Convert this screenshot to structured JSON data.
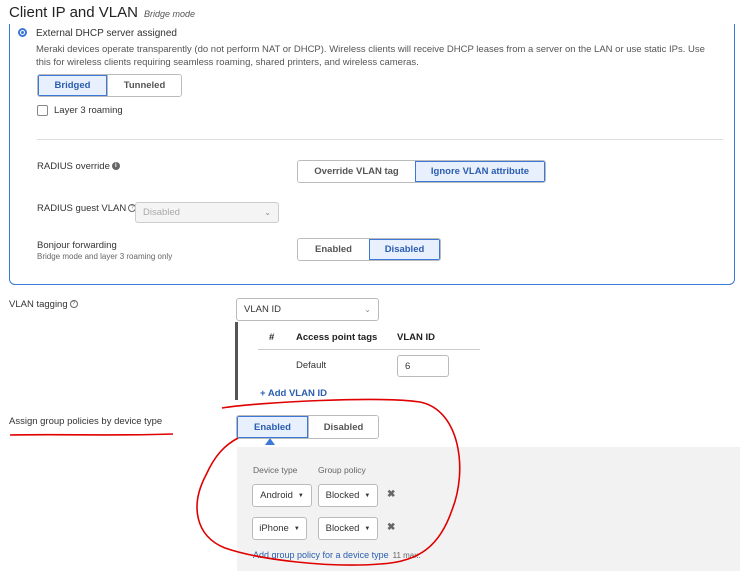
{
  "header": {
    "title": "Client IP and VLAN",
    "subtitle": "Bridge mode"
  },
  "dhcp": {
    "option_label": "External DHCP server assigned",
    "description": "Meraki devices operate transparently (do not perform NAT or DHCP). Wireless clients will receive DHCP leases from a server on the LAN or use static IPs. Use this for wireless clients requiring seamless roaming, shared printers, and wireless cameras.",
    "mode_buttons": [
      "Bridged",
      "Tunneled"
    ],
    "layer3_label": "Layer 3 roaming"
  },
  "radius_override": {
    "label": "RADIUS override",
    "options": [
      "Override VLAN tag",
      "Ignore VLAN attribute"
    ]
  },
  "radius_guest": {
    "label": "RADIUS guest VLAN",
    "value": "Disabled"
  },
  "bonjour": {
    "label": "Bonjour forwarding",
    "sublabel": "Bridge mode and layer 3 roaming only",
    "options": [
      "Enabled",
      "Disabled"
    ]
  },
  "vlan_tagging": {
    "label": "VLAN tagging",
    "select_value": "VLAN ID",
    "table": {
      "headers": [
        "#",
        "Access point tags",
        "VLAN ID"
      ],
      "rows": [
        {
          "tag": "Default",
          "vlan": "6"
        }
      ]
    },
    "add_label": "+ Add VLAN ID"
  },
  "group_policies": {
    "label": "Assign group policies by device type",
    "options": [
      "Enabled",
      "Disabled"
    ],
    "col_device": "Device type",
    "col_policy": "Group policy",
    "rows": [
      {
        "device": "Android",
        "policy": "Blocked"
      },
      {
        "device": "iPhone",
        "policy": "Blocked"
      }
    ],
    "add_link": "Add group policy for a device type",
    "max_note": "11 max."
  },
  "colors": {
    "accent": "#3c78d8",
    "annotation": "#e00000"
  }
}
